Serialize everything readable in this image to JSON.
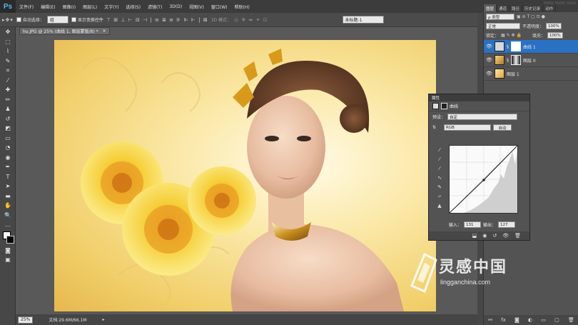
{
  "app": {
    "logo": "Ps",
    "window_controls": [
      "–",
      "▫",
      "✕"
    ]
  },
  "menu": [
    "文件(F)",
    "编辑(E)",
    "图像(I)",
    "图层(L)",
    "文字(Y)",
    "选择(S)",
    "滤镜(T)",
    "3D(D)",
    "视图(V)",
    "窗口(W)",
    "帮助(H)"
  ],
  "options": {
    "auto_select_label": "自动选择：",
    "auto_select_value": "组",
    "show_transform_label": "显示变换控件",
    "mode_3d_label": "3D 模式：",
    "workspace_value": "未标题-1"
  },
  "document": {
    "tab_title": "hu.JPG @ 25% (曲线 1, 图层蒙版/8) *",
    "tab_close": "×",
    "zoom": "25%",
    "doc_size": "文档:29.6M/66.1M"
  },
  "layers_panel": {
    "tabs": [
      "图层",
      "通道",
      "路径",
      "历史记录",
      "动作"
    ],
    "filter_label": "ρ 类型",
    "blend_mode": "正常",
    "opacity_label": "不透明度：",
    "opacity_value": "100%",
    "lock_label": "锁定：",
    "fill_label": "填充：",
    "fill_value": "100%",
    "layers": [
      {
        "name": "曲线 1",
        "selected": true
      },
      {
        "name": "图层 0",
        "selected": false
      },
      {
        "name": "图层 1",
        "selected": false
      }
    ]
  },
  "properties": {
    "title": "属性",
    "adjustment": "曲线",
    "preset_label": "预设：",
    "preset_value": "自定",
    "channel_value": "RGB",
    "auto_button": "自动",
    "input_label": "输入：",
    "input_value": "131",
    "output_label": "输出：",
    "output_value": "127"
  },
  "watermark": {
    "title": "灵感中国",
    "subtitle": "lingganchina.com"
  },
  "colors": {
    "accent": "#2a71c4",
    "canvas_gold": "#f1cf6a"
  }
}
